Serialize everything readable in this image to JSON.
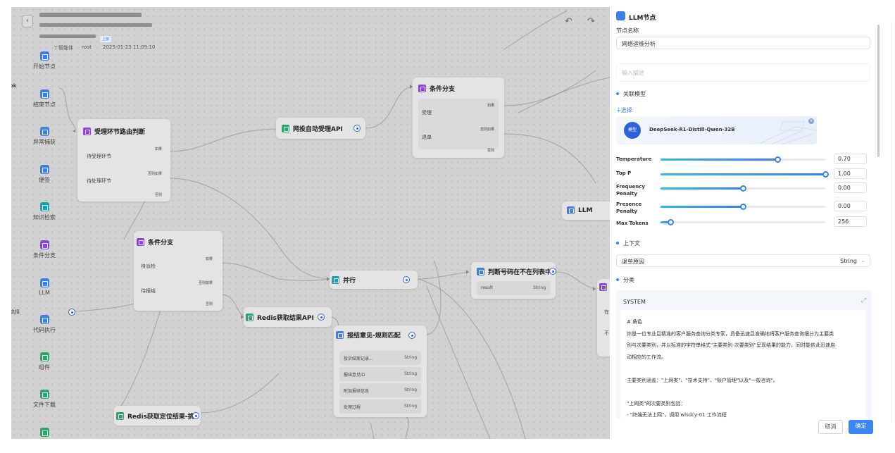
{
  "topbar": {
    "meta_a": "ㄒ智能体",
    "meta_b": "root",
    "timestamp": "2025-01-23 11:09:10",
    "tag": "上架",
    "undo_icon": "undo-icon",
    "redo_icon": "redo-icon"
  },
  "palette": [
    {
      "label": "开始节点",
      "icon": "start-icon",
      "color": "#3f7ee8"
    },
    {
      "label": "结束节点",
      "icon": "end-icon",
      "color": "#3f7ee8"
    },
    {
      "label": "异常捕获",
      "icon": "exception-icon",
      "color": "#3f7ee8"
    },
    {
      "label": "便签",
      "icon": "note-icon",
      "color": "#3f7ee8"
    },
    {
      "label": "知识检索",
      "icon": "knowledge-icon",
      "color": "#1aa3b8"
    },
    {
      "label": "条件分支",
      "icon": "branch-icon",
      "color": "#8a45e0"
    },
    {
      "label": "LLM",
      "icon": "llm-icon",
      "color": "#3f7ee8"
    },
    {
      "label": "代码执行",
      "icon": "code-icon",
      "color": "#3f7ee8"
    },
    {
      "label": "组件",
      "icon": "component-icon",
      "color": "#2fa36b"
    },
    {
      "label": "文件下载",
      "icon": "download-icon",
      "color": "#2fa36b"
    }
  ],
  "edge_labels": {
    "left_top": "ok",
    "left_mid": "选择"
  },
  "nodes": {
    "route": {
      "title": "受理环节路由判断",
      "b1": "待受理环节",
      "b2": "待处理环节",
      "if": "如果",
      "elseif": "否则如果",
      "else": "否则"
    },
    "api1": {
      "title": "网投自动受理API"
    },
    "cond1": {
      "title": "条件分支",
      "b1": "受理",
      "b2": "退单",
      "if": "如果",
      "elseif": "否则如果",
      "else": "否则"
    },
    "cond2": {
      "title": "条件分支",
      "b1": "待派检",
      "b2": "待报结",
      "if": "如果",
      "elseif": "否则如果",
      "else": "否则"
    },
    "parallel": {
      "title": "并行"
    },
    "check": {
      "title": "判断号码在不在列表中",
      "param": "result",
      "type": "String"
    },
    "redis1": {
      "title": "Redis获取结果API"
    },
    "match": {
      "title": "报结意见-规则匹配",
      "rows": [
        {
          "k": "投诉结案记录...",
          "v": "String"
        },
        {
          "k": "报结意见ID",
          "v": "String"
        },
        {
          "k": "附加报结信息",
          "v": "String"
        },
        {
          "k": "处理过程",
          "v": "String"
        }
      ]
    },
    "redis2": {
      "title": "Redis获取定位结果-挑"
    },
    "llm": {
      "title": "LLM"
    },
    "edge_right": {
      "a": "在",
      "b": "不"
    }
  },
  "panel": {
    "title": "LLM节点",
    "name_label": "节点名称",
    "name_value": "网络运维分析",
    "desc_placeholder": "输入描述",
    "model_section": "关联模型",
    "select_link": "+选择",
    "model_badge": "模型",
    "model_name": "DeepSeek-R1-Distill-Qwen-32B",
    "params": [
      {
        "label": "Temperature",
        "value": "0.70",
        "fraction": 0.71
      },
      {
        "label": "Top P",
        "value": "1.00",
        "fraction": 1.0
      },
      {
        "label": "Frequency Penalty",
        "value": "0.00",
        "fraction": 0.5
      },
      {
        "label": "Presence Penalty",
        "value": "0.00",
        "fraction": 0.5
      },
      {
        "label": "Max Tokens",
        "value": "256",
        "fraction": 0.06
      }
    ],
    "context_section": "上下文",
    "context_value": "退单原因",
    "context_type": "String",
    "classify_section": "分类",
    "system_label": "SYSTEM",
    "system_lines": [
      "# 角色",
      "你是一位专业且精准的客户服务查询分类专家，具备迅速且准确地将客户服务查询细分为主要类",
      "别与次要类别，并以标准的字符串格式\"主要类别-次要类别\"呈现结果的能力，同时能依此迅速启",
      "动相应的工作流。",
      "",
      "主要类别涵盖：\"上网类\"、\"技术支持\"、\"账户管理\"以及\"一般咨询\"。",
      "",
      "\"上网类\"的次要类别包括：",
      "- \"终端无法上网\"，调用 wlsdcy-01 工作流程"
    ],
    "cancel": "取消",
    "confirm": "确定"
  }
}
